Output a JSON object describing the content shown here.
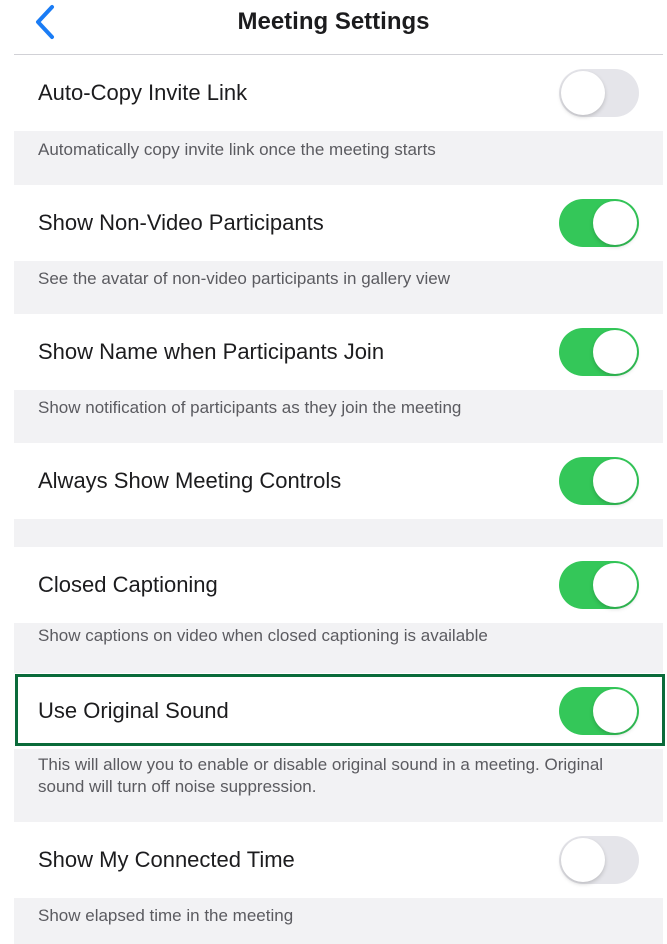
{
  "header": {
    "title": "Meeting Settings",
    "back_icon": "chevron-left-icon"
  },
  "colors": {
    "accent_blue": "#1a7cf5",
    "toggle_on": "#34c759",
    "toggle_off": "#e5e5ea",
    "highlight_border": "#0a6b3a",
    "section_bg": "#f2f2f4"
  },
  "settings": [
    {
      "label": "Auto-Copy Invite Link",
      "enabled": false,
      "description": "Automatically copy invite link once the meeting starts"
    },
    {
      "label": "Show Non-Video Participants",
      "enabled": true,
      "description": "See the avatar of non-video participants in gallery view"
    },
    {
      "label": "Show Name when Participants Join",
      "enabled": true,
      "description": "Show notification of participants as they join the meeting"
    },
    {
      "label": "Always Show Meeting Controls",
      "enabled": true,
      "description": ""
    },
    {
      "label": "Closed Captioning",
      "enabled": true,
      "description": "Show captions on video when closed captioning is available"
    },
    {
      "label": "Use Original Sound",
      "enabled": true,
      "highlighted": true,
      "description": "This will allow you to enable or disable original sound in a meeting. Original sound will turn off noise suppression."
    },
    {
      "label": "Show My Connected Time",
      "enabled": false,
      "description": "Show elapsed time in the meeting"
    }
  ]
}
